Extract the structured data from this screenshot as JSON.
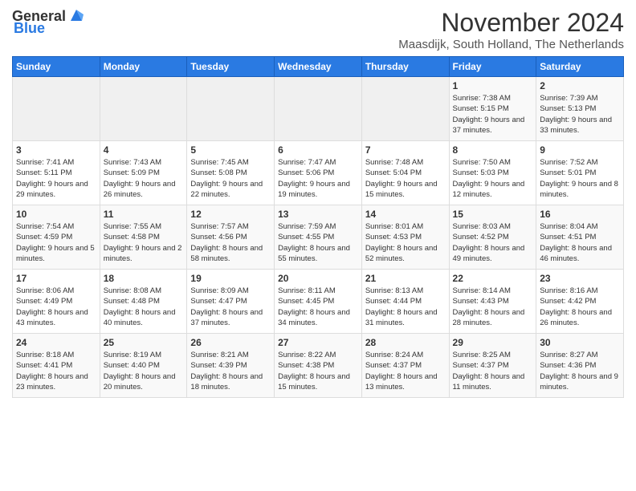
{
  "header": {
    "logo_general": "General",
    "logo_blue": "Blue",
    "title": "November 2024",
    "location": "Maasdijk, South Holland, The Netherlands"
  },
  "calendar": {
    "days_of_week": [
      "Sunday",
      "Monday",
      "Tuesday",
      "Wednesday",
      "Thursday",
      "Friday",
      "Saturday"
    ],
    "weeks": [
      [
        {
          "day": "",
          "info": ""
        },
        {
          "day": "",
          "info": ""
        },
        {
          "day": "",
          "info": ""
        },
        {
          "day": "",
          "info": ""
        },
        {
          "day": "",
          "info": ""
        },
        {
          "day": "1",
          "info": "Sunrise: 7:38 AM\nSunset: 5:15 PM\nDaylight: 9 hours and 37 minutes."
        },
        {
          "day": "2",
          "info": "Sunrise: 7:39 AM\nSunset: 5:13 PM\nDaylight: 9 hours and 33 minutes."
        }
      ],
      [
        {
          "day": "3",
          "info": "Sunrise: 7:41 AM\nSunset: 5:11 PM\nDaylight: 9 hours and 29 minutes."
        },
        {
          "day": "4",
          "info": "Sunrise: 7:43 AM\nSunset: 5:09 PM\nDaylight: 9 hours and 26 minutes."
        },
        {
          "day": "5",
          "info": "Sunrise: 7:45 AM\nSunset: 5:08 PM\nDaylight: 9 hours and 22 minutes."
        },
        {
          "day": "6",
          "info": "Sunrise: 7:47 AM\nSunset: 5:06 PM\nDaylight: 9 hours and 19 minutes."
        },
        {
          "day": "7",
          "info": "Sunrise: 7:48 AM\nSunset: 5:04 PM\nDaylight: 9 hours and 15 minutes."
        },
        {
          "day": "8",
          "info": "Sunrise: 7:50 AM\nSunset: 5:03 PM\nDaylight: 9 hours and 12 minutes."
        },
        {
          "day": "9",
          "info": "Sunrise: 7:52 AM\nSunset: 5:01 PM\nDaylight: 9 hours and 8 minutes."
        }
      ],
      [
        {
          "day": "10",
          "info": "Sunrise: 7:54 AM\nSunset: 4:59 PM\nDaylight: 9 hours and 5 minutes."
        },
        {
          "day": "11",
          "info": "Sunrise: 7:55 AM\nSunset: 4:58 PM\nDaylight: 9 hours and 2 minutes."
        },
        {
          "day": "12",
          "info": "Sunrise: 7:57 AM\nSunset: 4:56 PM\nDaylight: 8 hours and 58 minutes."
        },
        {
          "day": "13",
          "info": "Sunrise: 7:59 AM\nSunset: 4:55 PM\nDaylight: 8 hours and 55 minutes."
        },
        {
          "day": "14",
          "info": "Sunrise: 8:01 AM\nSunset: 4:53 PM\nDaylight: 8 hours and 52 minutes."
        },
        {
          "day": "15",
          "info": "Sunrise: 8:03 AM\nSunset: 4:52 PM\nDaylight: 8 hours and 49 minutes."
        },
        {
          "day": "16",
          "info": "Sunrise: 8:04 AM\nSunset: 4:51 PM\nDaylight: 8 hours and 46 minutes."
        }
      ],
      [
        {
          "day": "17",
          "info": "Sunrise: 8:06 AM\nSunset: 4:49 PM\nDaylight: 8 hours and 43 minutes."
        },
        {
          "day": "18",
          "info": "Sunrise: 8:08 AM\nSunset: 4:48 PM\nDaylight: 8 hours and 40 minutes."
        },
        {
          "day": "19",
          "info": "Sunrise: 8:09 AM\nSunset: 4:47 PM\nDaylight: 8 hours and 37 minutes."
        },
        {
          "day": "20",
          "info": "Sunrise: 8:11 AM\nSunset: 4:45 PM\nDaylight: 8 hours and 34 minutes."
        },
        {
          "day": "21",
          "info": "Sunrise: 8:13 AM\nSunset: 4:44 PM\nDaylight: 8 hours and 31 minutes."
        },
        {
          "day": "22",
          "info": "Sunrise: 8:14 AM\nSunset: 4:43 PM\nDaylight: 8 hours and 28 minutes."
        },
        {
          "day": "23",
          "info": "Sunrise: 8:16 AM\nSunset: 4:42 PM\nDaylight: 8 hours and 26 minutes."
        }
      ],
      [
        {
          "day": "24",
          "info": "Sunrise: 8:18 AM\nSunset: 4:41 PM\nDaylight: 8 hours and 23 minutes."
        },
        {
          "day": "25",
          "info": "Sunrise: 8:19 AM\nSunset: 4:40 PM\nDaylight: 8 hours and 20 minutes."
        },
        {
          "day": "26",
          "info": "Sunrise: 8:21 AM\nSunset: 4:39 PM\nDaylight: 8 hours and 18 minutes."
        },
        {
          "day": "27",
          "info": "Sunrise: 8:22 AM\nSunset: 4:38 PM\nDaylight: 8 hours and 15 minutes."
        },
        {
          "day": "28",
          "info": "Sunrise: 8:24 AM\nSunset: 4:37 PM\nDaylight: 8 hours and 13 minutes."
        },
        {
          "day": "29",
          "info": "Sunrise: 8:25 AM\nSunset: 4:37 PM\nDaylight: 8 hours and 11 minutes."
        },
        {
          "day": "30",
          "info": "Sunrise: 8:27 AM\nSunset: 4:36 PM\nDaylight: 8 hours and 9 minutes."
        }
      ]
    ]
  }
}
